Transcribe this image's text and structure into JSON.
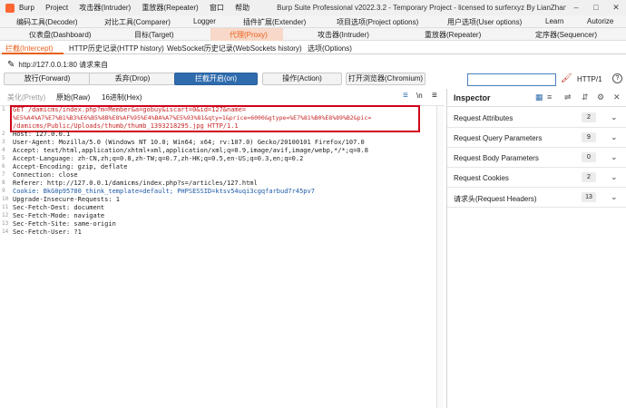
{
  "app": {
    "menu": [
      "Burp",
      "Project",
      "攻击器(Intruder)",
      "重放器(Repeater)",
      "窗口",
      "帮助"
    ],
    "title": "Burp Suite Professional v2022.3.2 - Temporary Project - licensed to surferxyz By LianZhang.org By LianZhang...",
    "window_controls": [
      "–",
      "□",
      "✕"
    ]
  },
  "tabs_row1": [
    "编码工具(Decoder)",
    "对比工具(Comparer)",
    "Logger",
    "插件扩展(Extender)",
    "项目选项(Project options)",
    "用户选项(User options)",
    "Learn",
    "Autorize"
  ],
  "tabs_row2": [
    "仪表盘(Dashboard)",
    "目标(Target)",
    "代理(Proxy)",
    "攻击器(Intruder)",
    "重放器(Repeater)",
    "定序器(Sequencer)"
  ],
  "subtabs": [
    "拦截(Intercept)",
    "HTTP历史记录(HTTP history)",
    "WebSocket历史记录(WebSockets history)",
    "选项(Options)"
  ],
  "request_info": "http://127.0.0.1:80 请求来自",
  "toolbar": {
    "forward": "放行(Forward)",
    "drop": "丢弃(Drop)",
    "intercept": "拦截开启(on)",
    "action": "操作(Action)",
    "browser": "打开浏览器(Chromium)",
    "search_value": "",
    "protocol": "HTTP/1",
    "help": "?"
  },
  "editor_tabs": [
    "美化(Pretty)",
    "原始(Raw)",
    "16进制(Hex)"
  ],
  "editor_tab_icons": [
    "≡",
    "\\n",
    "≡"
  ],
  "request_lines": [
    "GET /damicms/index.php?m=Member&a=gobuy&iscart=0&id=127&name=",
    "%E5%A4%A7%E7%B1%B3%E6%B5%8B%E8%AF%95%E4%BA%A7%E5%93%81&qty=1&price=6000&gtype=%E7%81%B0%E8%89%B2&pic=",
    "/damicms/Public/Uploads/thumb/thumb_1393218295.jpg HTTP/1.1",
    "Host: 127.0.0.1",
    "User-Agent: Mozilla/5.0 (Windows NT 10.0; Win64; x64; rv:107.0) Gecko/20100101 Firefox/107.0",
    "Accept: text/html,application/xhtml+xml,application/xml;q=0.9,image/avif,image/webp,*/*;q=0.8",
    "Accept-Language: zh-CN,zh;q=0.8,zh-TW;q=0.7,zh-HK;q=0.5,en-US;q=0.3,en;q=0.2",
    "Accept-Encoding: gzip, deflate",
    "Connection: close",
    "Referer: http://127.0.0.1/damicms/index.php?s=/articles/127.html",
    "Cookie: BkG0p95780_think_template=default; PHPSESSID=ktsv54uqi3cgqfarbud7r45pv7",
    "Upgrade-Insecure-Requests: 1",
    "Sec-Fetch-Dest: document",
    "Sec-Fetch-Mode: navigate",
    "Sec-Fetch-Site: same-origin",
    "Sec-Fetch-User: ?1"
  ],
  "line_numbers": [
    "1",
    "",
    "",
    "2",
    "3",
    "4",
    "5",
    "6",
    "7",
    "8",
    "9",
    "10",
    "11",
    "12",
    "13",
    "14"
  ],
  "inspector": {
    "title": "Inspector",
    "icons": [
      "▦",
      "≡",
      "⇌",
      "⇵",
      "⚙",
      "✕"
    ],
    "rows": [
      {
        "label": "Request Attributes",
        "count": "2"
      },
      {
        "label": "Request Query Parameters",
        "count": "9"
      },
      {
        "label": "Request Body Parameters",
        "count": "0"
      },
      {
        "label": "Request Cookies",
        "count": "2"
      },
      {
        "label": "请求头(Request Headers)",
        "count": "13"
      }
    ],
    "chevron": "⌄"
  }
}
